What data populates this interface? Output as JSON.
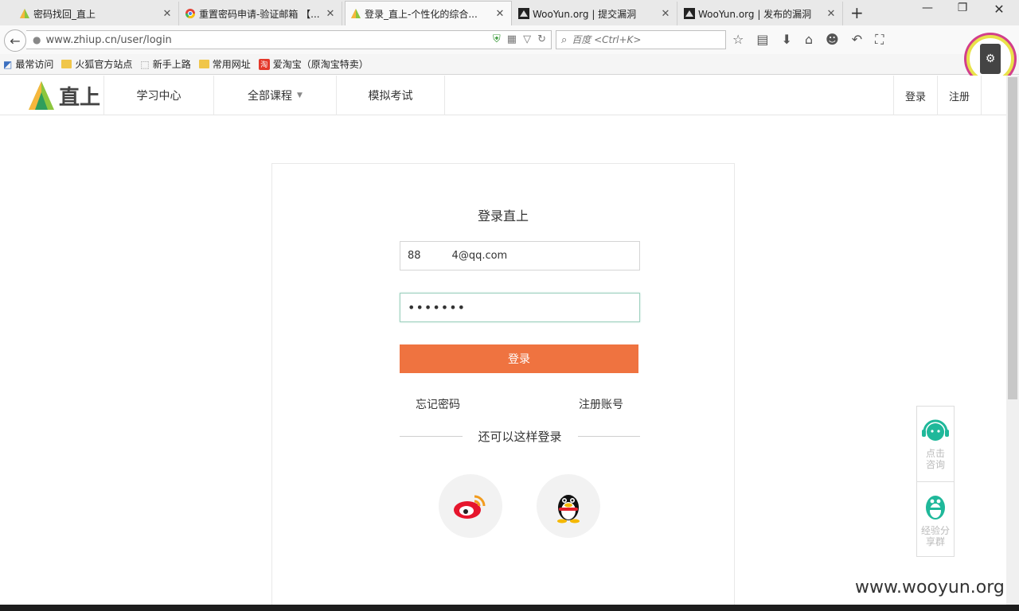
{
  "browser": {
    "tabs": [
      {
        "title": "密码找回_直上",
        "icon": "zhiup-logo-icon"
      },
      {
        "title": "重置密码申请-验证邮箱 【...",
        "icon": "chrome-icon"
      },
      {
        "title": "登录_直上-个性化的综合...",
        "icon": "zhiup-logo-icon",
        "active": true
      },
      {
        "title": "WooYun.org | 提交漏洞",
        "icon": "wooyun-icon"
      },
      {
        "title": "WooYun.org | 发布的漏洞",
        "icon": "wooyun-icon"
      }
    ],
    "url": "www.zhiup.cn/user/login",
    "search_placeholder": "百度 <Ctrl+K>",
    "bookmarks": [
      "最常访问",
      "火狐官方站点",
      "新手上路",
      "常用网址",
      "爱淘宝（原淘宝特卖）"
    ]
  },
  "site": {
    "logo_text": "直上",
    "nav": [
      "学习中心",
      "全部课程",
      "模拟考试"
    ],
    "login_link": "登录",
    "register_link": "注册"
  },
  "login": {
    "title": "登录直上",
    "email_value": "88   4@qq.com",
    "password_value": "•••••••",
    "submit_label": "登录",
    "forgot_label": "忘记密码",
    "register_label": "注册账号",
    "alt_label": "还可以这样登录"
  },
  "side": {
    "consult_label": "点击咨询",
    "group_label": "经验分享群"
  },
  "watermark": "www.wooyun.org"
}
